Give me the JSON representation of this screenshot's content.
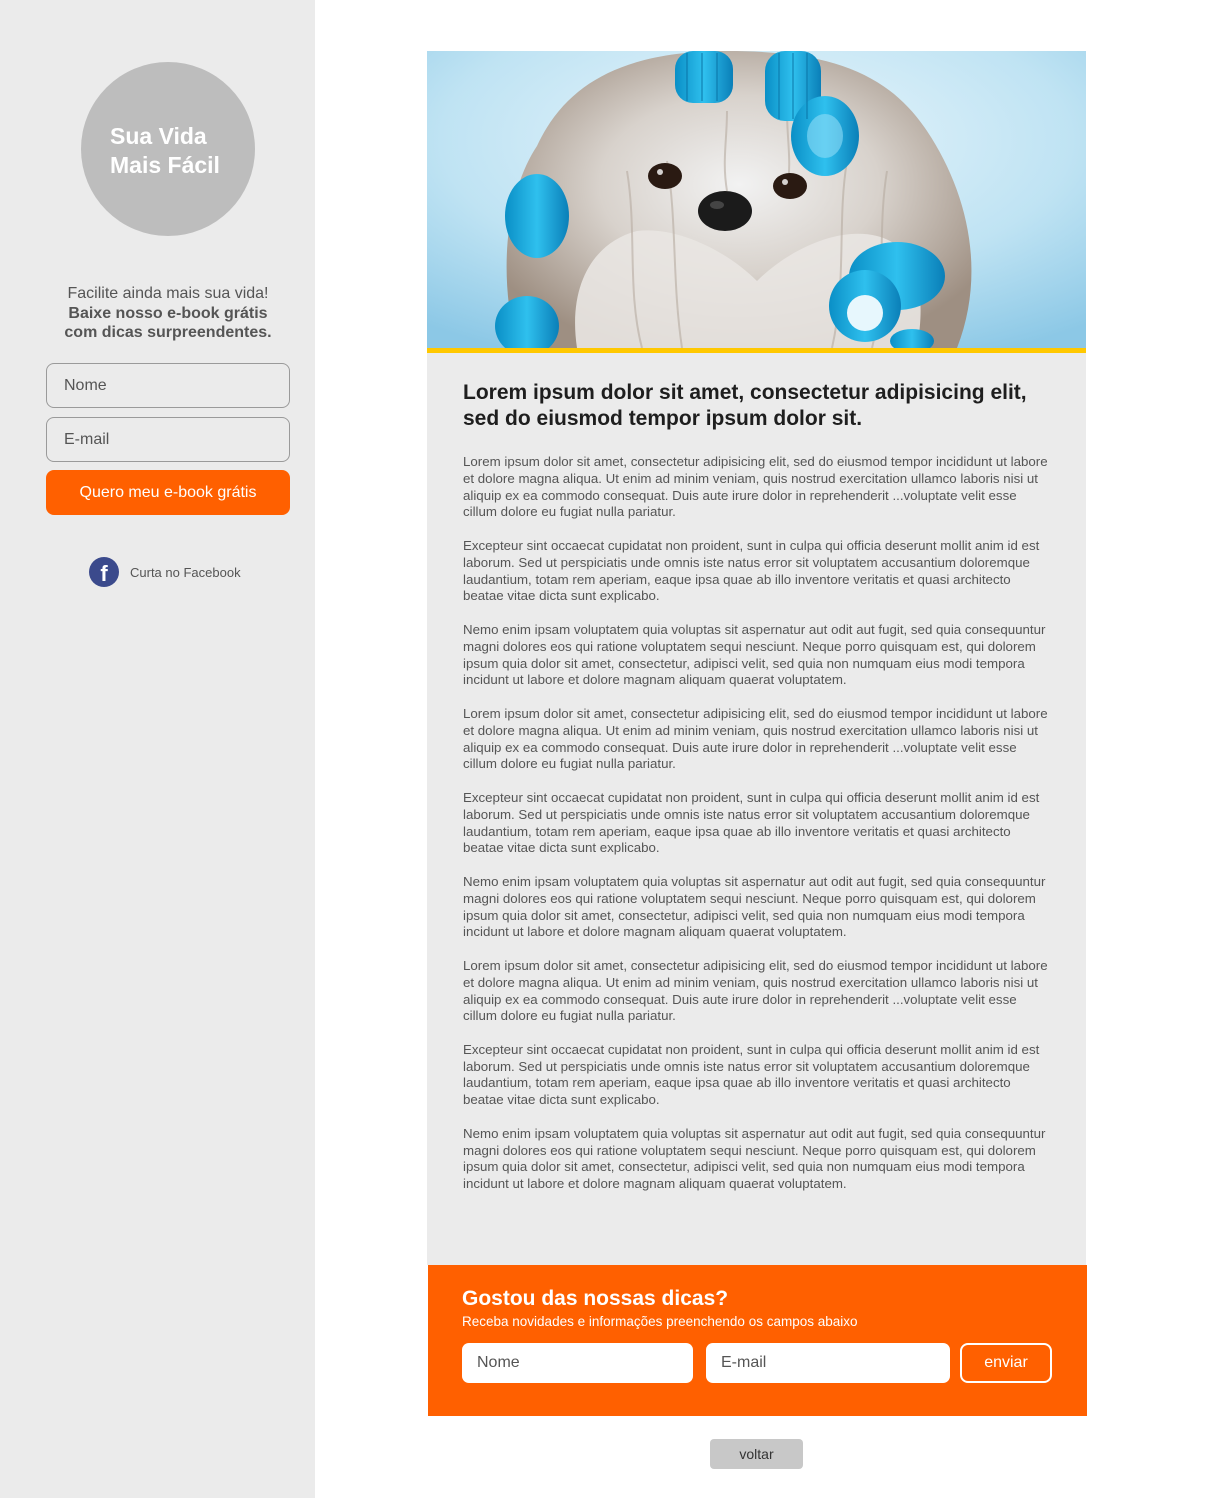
{
  "sidebar": {
    "logo_line1": "Sua Vida",
    "logo_line2": "Mais Fácil",
    "intro_line": "Facilite ainda mais sua vida!",
    "intro_bold_1": "Baixe nosso e-book grátis",
    "intro_bold_2": "com dicas surpreendentes.",
    "name_placeholder": "Nome",
    "email_placeholder": "E-mail",
    "cta_label": "Quero meu e-book grátis",
    "facebook_icon_letter": "f",
    "facebook_label": "Curta no Facebook"
  },
  "hero": {
    "image_description": "dog-with-blue-hair-rollers",
    "accent_color": "#ffc800"
  },
  "article": {
    "headline": "Lorem ipsum dolor sit amet, consectetur adipisicing elit, sed do eiusmod tempor ipsum dolor sit.",
    "paragraphs": [
      "Lorem ipsum dolor sit amet, consectetur adipisicing elit, sed do eiusmod tempor incididunt ut labore et dolore magna aliqua. Ut enim ad minim veniam, quis nostrud exercitation ullamco laboris nisi ut aliquip ex ea commodo consequat. Duis aute irure dolor in reprehenderit ...voluptate velit esse cillum dolore eu fugiat nulla pariatur.",
      "Excepteur sint occaecat cupidatat non proident, sunt in culpa qui officia deserunt mollit anim id est laborum. Sed ut perspiciatis unde omnis iste natus error sit voluptatem accusantium doloremque laudantium, totam rem aperiam, eaque ipsa quae ab illo inventore veritatis et quasi architecto beatae vitae dicta sunt explicabo.",
      "Nemo enim ipsam voluptatem quia voluptas sit aspernatur aut odit aut fugit, sed quia consequuntur magni dolores eos qui ratione voluptatem sequi nesciunt. Neque porro quisquam est, qui dolorem ipsum quia dolor sit amet, consectetur, adipisci velit, sed quia non numquam eius modi tempora incidunt ut labore et dolore magnam aliquam quaerat voluptatem.",
      "Lorem ipsum dolor sit amet, consectetur adipisicing elit, sed do eiusmod tempor incididunt ut labore et dolore magna aliqua. Ut enim ad minim veniam, quis nostrud exercitation ullamco laboris nisi ut aliquip ex ea commodo consequat. Duis aute irure dolor in reprehenderit ...voluptate velit esse cillum dolore eu fugiat nulla pariatur.",
      "Excepteur sint occaecat cupidatat non proident, sunt in culpa qui officia deserunt mollit anim id est laborum. Sed ut perspiciatis unde omnis iste natus error sit voluptatem accusantium doloremque laudantium, totam rem aperiam, eaque ipsa quae ab illo inventore veritatis et quasi architecto beatae vitae dicta sunt explicabo.",
      "Nemo enim ipsam voluptatem quia voluptas sit aspernatur aut odit aut fugit, sed quia consequuntur magni dolores eos qui ratione voluptatem sequi nesciunt. Neque porro quisquam est, qui dolorem ipsum quia dolor sit amet, consectetur, adipisci velit, sed quia non numquam eius modi tempora incidunt ut labore et dolore magnam aliquam quaerat voluptatem.",
      "Lorem ipsum dolor sit amet, consectetur adipisicing elit, sed do eiusmod tempor incididunt ut labore et dolore magna aliqua. Ut enim ad minim veniam, quis nostrud exercitation ullamco laboris nisi ut aliquip ex ea commodo consequat. Duis aute irure dolor in reprehenderit ...voluptate velit esse cillum dolore eu fugiat nulla pariatur.",
      "Excepteur sint occaecat cupidatat non proident, sunt in culpa qui officia deserunt mollit anim id est laborum. Sed ut perspiciatis unde omnis iste natus error sit voluptatem accusantium doloremque laudantium, totam rem aperiam, eaque ipsa quae ab illo inventore veritatis et quasi architecto beatae vitae dicta sunt explicabo.",
      "Nemo enim ipsam voluptatem quia voluptas sit aspernatur aut odit aut fugit, sed quia consequuntur magni dolores eos qui ratione voluptatem sequi nesciunt. Neque porro quisquam est, qui dolorem ipsum quia dolor sit amet, consectetur, adipisci velit, sed quia non numquam eius modi tempora incidunt ut labore et dolore magnam aliquam quaerat voluptatem."
    ]
  },
  "newsletter": {
    "title": "Gostou das nossas dicas?",
    "subtitle": "Receba novidades e informações preenchendo os campos abaixo",
    "name_placeholder": "Nome",
    "email_placeholder": "E-mail",
    "submit_label": "enviar",
    "background_color": "#ff6000"
  },
  "footer": {
    "back_label": "voltar"
  }
}
